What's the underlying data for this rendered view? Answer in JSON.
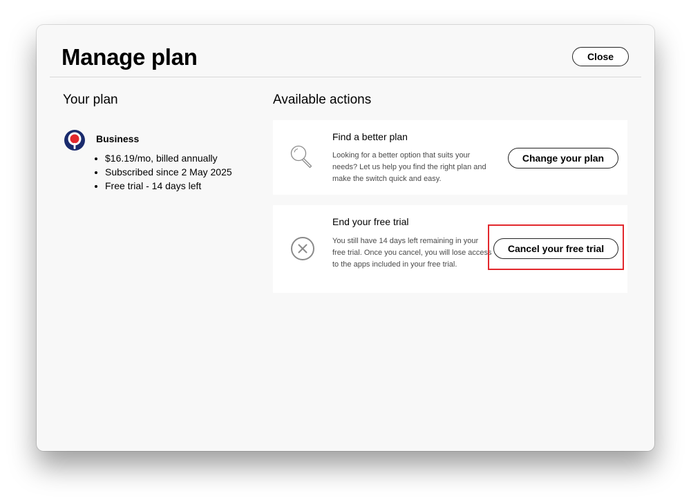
{
  "header": {
    "title": "Manage plan",
    "close_label": "Close"
  },
  "your_plan": {
    "section_title": "Your plan",
    "plan_name": "Business",
    "details": [
      "$16.19/mo, billed annually",
      "Subscribed since 2 May 2025",
      "Free trial - 14 days left"
    ],
    "logo_icon": "business-plan-logo-icon",
    "logo_colors": {
      "ring": "#1a2b6d",
      "dot": "#e2272c"
    }
  },
  "actions": {
    "section_title": "Available actions",
    "cards": [
      {
        "icon": "magnifier-icon",
        "heading": "Find a better plan",
        "text": "Looking for a better option that suits your needs? Let us help you find the right plan and make the switch quick and easy.",
        "button_label": "Change your plan"
      },
      {
        "icon": "cancel-x-icon",
        "heading": "End your free trial",
        "text": "You still have 14 days left remaining in your free trial. Once you cancel, you will lose access to the apps included in your free trial.",
        "button_label": "Cancel your free trial"
      }
    ]
  },
  "colors": {
    "window_bg": "#f8f8f8",
    "card_bg": "#ffffff",
    "highlight": "#e2272c"
  }
}
